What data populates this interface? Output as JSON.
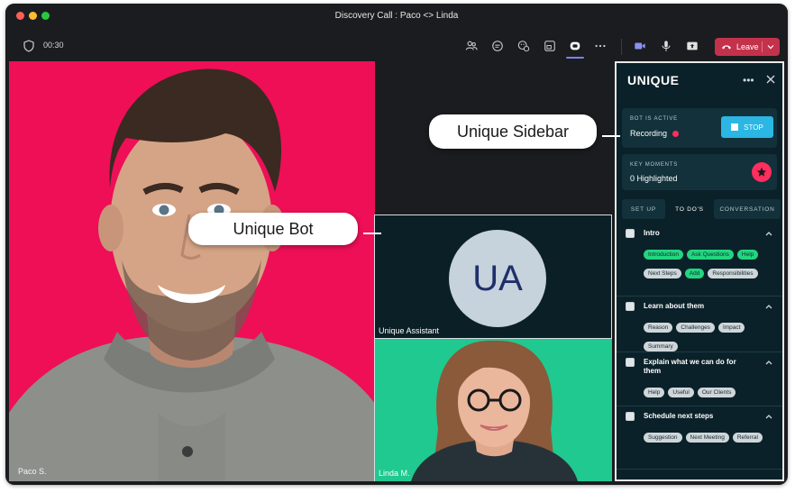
{
  "window": {
    "title": "Discovery Call : Paco <> Linda"
  },
  "toolbar": {
    "timer": "00:30",
    "leave_label": "Leave",
    "icons": [
      "people-icon",
      "chat-icon",
      "reactions-icon",
      "share-tray-icon",
      "unique-app-icon",
      "more-icon",
      "camera-icon",
      "mic-icon",
      "share-icon",
      "phone-hangup-icon"
    ]
  },
  "callouts": {
    "sidebar": "Unique Sidebar",
    "bot": "Unique Bot"
  },
  "participants": {
    "main": {
      "name": "Paco S."
    },
    "assistant": {
      "initials": "UA",
      "name": "Unique Assistant"
    },
    "linda": {
      "name": "Linda M."
    }
  },
  "sidebar": {
    "logo": "UNIQUE",
    "bot_status": {
      "label": "BOT IS ACTIVE",
      "value": "Recording",
      "stop_label": "STOP"
    },
    "key_moments": {
      "label": "KEY MOMENTS",
      "value": "0 Highlighted"
    },
    "tabs": [
      "SET UP",
      "TO DO'S",
      "CONVERSATION"
    ],
    "active_tab": "TO DO'S",
    "sections": [
      {
        "title": "Intro",
        "chips": [
          {
            "label": "Introduction",
            "style": "green"
          },
          {
            "label": "Ask Questions",
            "style": "green"
          },
          {
            "label": "Help",
            "style": "green"
          },
          {
            "label": "Next Steps",
            "style": "grey"
          },
          {
            "label": "Add",
            "style": "green"
          },
          {
            "label": "Responsibilities",
            "style": "grey"
          }
        ]
      },
      {
        "title": "Learn about them",
        "chips": [
          {
            "label": "Reason",
            "style": "grey"
          },
          {
            "label": "Challenges",
            "style": "grey"
          },
          {
            "label": "Impact",
            "style": "grey"
          },
          {
            "label": "Summary",
            "style": "grey"
          }
        ]
      },
      {
        "title": "Explain what we can do for them",
        "chips": [
          {
            "label": "Help",
            "style": "grey"
          },
          {
            "label": "Useful",
            "style": "grey"
          },
          {
            "label": "Our Clients",
            "style": "grey"
          }
        ]
      },
      {
        "title": "Schedule next steps",
        "chips": [
          {
            "label": "Suggestion",
            "style": "grey"
          },
          {
            "label": "Next Meeting",
            "style": "grey"
          },
          {
            "label": "Referral",
            "style": "grey"
          }
        ]
      }
    ]
  },
  "colors": {
    "window_bg": "#1b1c1f",
    "main_video_bg": "#ee0f57",
    "linda_bg": "#1fc98f",
    "sidebar_bg": "#0b2129",
    "accent_green": "#22d67f",
    "stop_blue": "#2bb6e3",
    "record_red": "#ff2e5f",
    "leave_red": "#c4314b"
  }
}
